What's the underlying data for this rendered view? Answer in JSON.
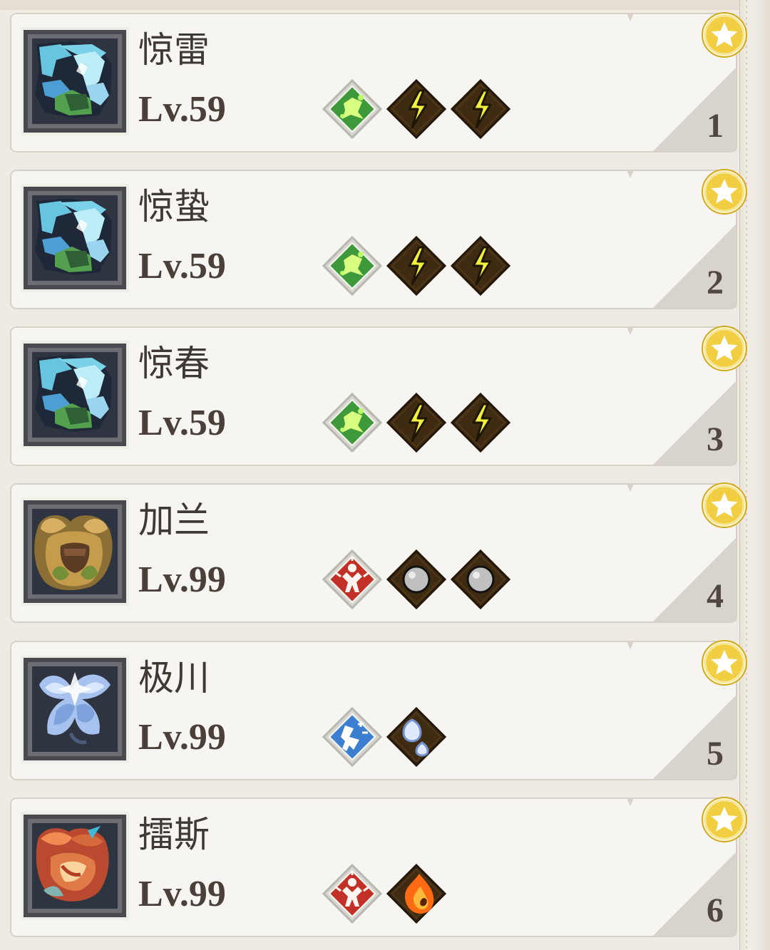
{
  "screen": {
    "title": ""
  },
  "palette": {
    "card_fill": "#f7f5f1",
    "card_border": "#d7d0c6",
    "rank_fill": "#d6d1ca",
    "gold": "#f2cf42",
    "gold_rim": "#d1a91d",
    "gem_dark": "#3f2b12",
    "gem_frame": "#d8d8d1",
    "green_gem": "#3d9939",
    "red_gem": "#c33028",
    "blue_gem": "#3c7fd0",
    "thunder": "#f2f03a",
    "silver": "#c0c0c0"
  },
  "cards": [
    {
      "name": "惊雷",
      "level": "Lv.59",
      "rank": "1",
      "portrait_icon": "blue-thunder-wyvern-icon",
      "portrait_palette": "thunder",
      "slot_icons": [
        "green-buff-gem-icon",
        "thunder-gem-icon",
        "thunder-gem-icon"
      ],
      "favorite_icon": "favorite-star-icon"
    },
    {
      "name": "惊蛰",
      "level": "Lv.59",
      "rank": "2",
      "portrait_icon": "blue-thunder-wyvern-icon",
      "portrait_palette": "thunder",
      "slot_icons": [
        "green-buff-gem-icon",
        "thunder-gem-icon",
        "thunder-gem-icon"
      ],
      "favorite_icon": "favorite-star-icon"
    },
    {
      "name": "惊春",
      "level": "Lv.59",
      "rank": "3",
      "portrait_icon": "blue-thunder-wyvern-icon",
      "portrait_palette": "thunder",
      "slot_icons": [
        "green-buff-gem-icon",
        "thunder-gem-icon",
        "thunder-gem-icon"
      ],
      "favorite_icon": "favorite-star-icon"
    },
    {
      "name": "加兰",
      "level": "Lv.99",
      "rank": "4",
      "portrait_icon": "horned-brute-icon",
      "portrait_palette": "brute",
      "slot_icons": [
        "red-power-gem-icon",
        "silver-orb-icon",
        "silver-orb-icon"
      ],
      "favorite_icon": "favorite-star-icon"
    },
    {
      "name": "极川",
      "level": "Lv.99",
      "rank": "5",
      "portrait_icon": "ice-moth-icon",
      "portrait_palette": "ice",
      "slot_icons": [
        "blue-speed-gem-icon",
        "water-drop-gem-icon"
      ],
      "favorite_icon": "favorite-star-icon"
    },
    {
      "name": "擂斯",
      "level": "Lv.99",
      "rank": "6",
      "portrait_icon": "fire-drake-icon",
      "portrait_palette": "fire",
      "slot_icons": [
        "red-power-gem-icon",
        "fire-gem-icon"
      ],
      "favorite_icon": "favorite-star-icon"
    }
  ]
}
